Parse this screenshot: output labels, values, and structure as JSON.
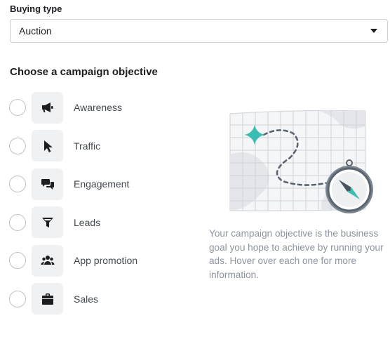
{
  "buying_type": {
    "label": "Buying type",
    "selected": "Auction"
  },
  "objective_section": {
    "title": "Choose a campaign objective",
    "objectives": [
      {
        "label": "Awareness",
        "icon": "megaphone-icon"
      },
      {
        "label": "Traffic",
        "icon": "cursor-icon"
      },
      {
        "label": "Engagement",
        "icon": "chat-bubbles-icon"
      },
      {
        "label": "Leads",
        "icon": "funnel-icon"
      },
      {
        "label": "App promotion",
        "icon": "people-icon"
      },
      {
        "label": "Sales",
        "icon": "shopping-bag-icon"
      }
    ]
  },
  "info": {
    "description": "Your campaign objective is the business goal you hope to achieve by running your ads. Hover over each one for more information."
  },
  "colors": {
    "accent_teal": "#3dbcb4",
    "text_primary": "#1c1e21",
    "text_muted": "#8d949e",
    "icon_bg": "#f0f1f3"
  }
}
